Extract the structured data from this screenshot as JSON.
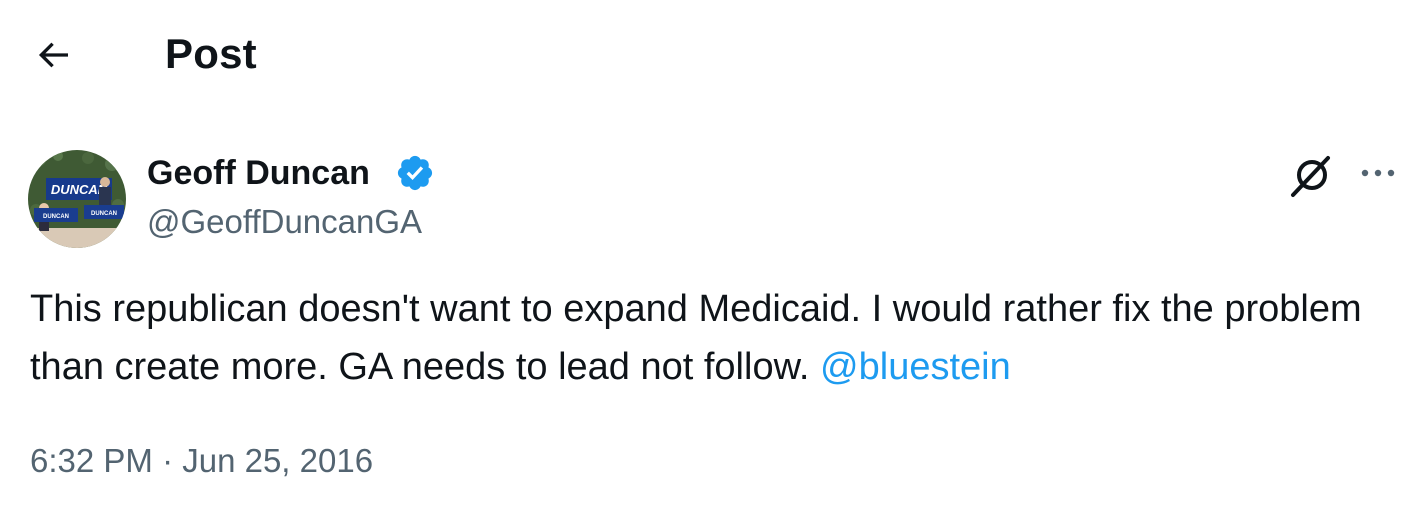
{
  "header": {
    "back_icon": "arrow-left-icon",
    "title": "Post"
  },
  "author": {
    "display_name": "Geoff Duncan",
    "handle": "@GeoffDuncanGA",
    "verified": true,
    "verified_color": "#1d9bf0",
    "avatar_sign_text": "DUNCAN",
    "avatar_banner_left": "DUNCAN",
    "avatar_banner_right": "DUNCAN"
  },
  "actions": {
    "grok_icon": "grok-icon",
    "more_icon": "more-horizontal-icon"
  },
  "post": {
    "text": "This republican doesn't want to expand Medicaid. I would rather fix the problem than create more. GA needs to lead not follow. ",
    "mention": "@bluestein",
    "mention_color": "#1d9bf0",
    "timestamp": "6:32 PM · Jun 25, 2016"
  }
}
